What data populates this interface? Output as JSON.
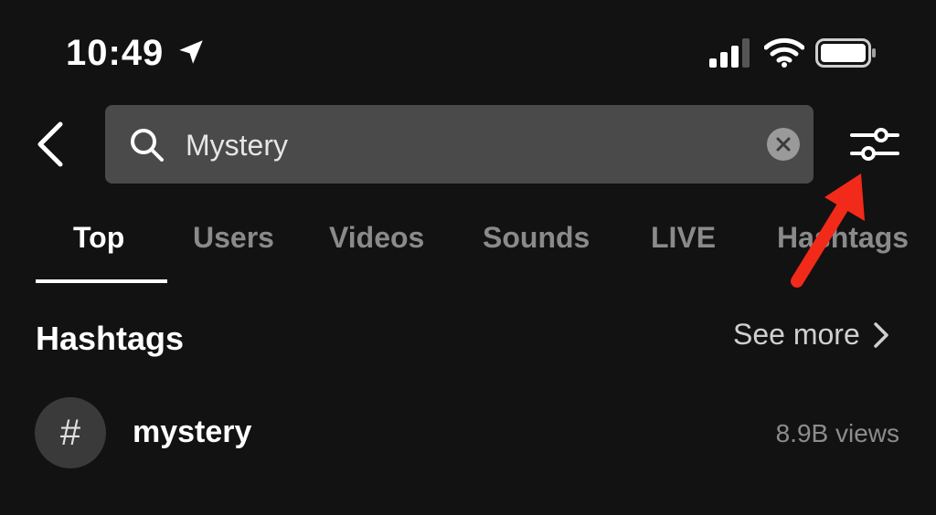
{
  "status_bar": {
    "time": "10:49",
    "icons": [
      "location-arrow-icon",
      "cellular-signal-icon",
      "wifi-icon",
      "battery-icon"
    ]
  },
  "search": {
    "value": "Mystery",
    "icons": [
      "back-chevron-icon",
      "search-icon",
      "clear-x-icon",
      "filter-sliders-icon"
    ]
  },
  "tabs": [
    {
      "label": "Top",
      "active": true
    },
    {
      "label": "Users",
      "active": false
    },
    {
      "label": "Videos",
      "active": false
    },
    {
      "label": "Sounds",
      "active": false
    },
    {
      "label": "LIVE",
      "active": false
    },
    {
      "label": "Hashtags",
      "active": false
    }
  ],
  "section": {
    "title": "Hashtags",
    "see_more_label": "See more"
  },
  "hashtag_results": [
    {
      "symbol": "#",
      "name": "mystery",
      "views": "8.9B views"
    }
  ],
  "colors": {
    "background": "#121212",
    "search_box": "#4a4a4a",
    "inactive_tab": "#8a8a8a",
    "annotation_arrow": "#f22a1a"
  }
}
